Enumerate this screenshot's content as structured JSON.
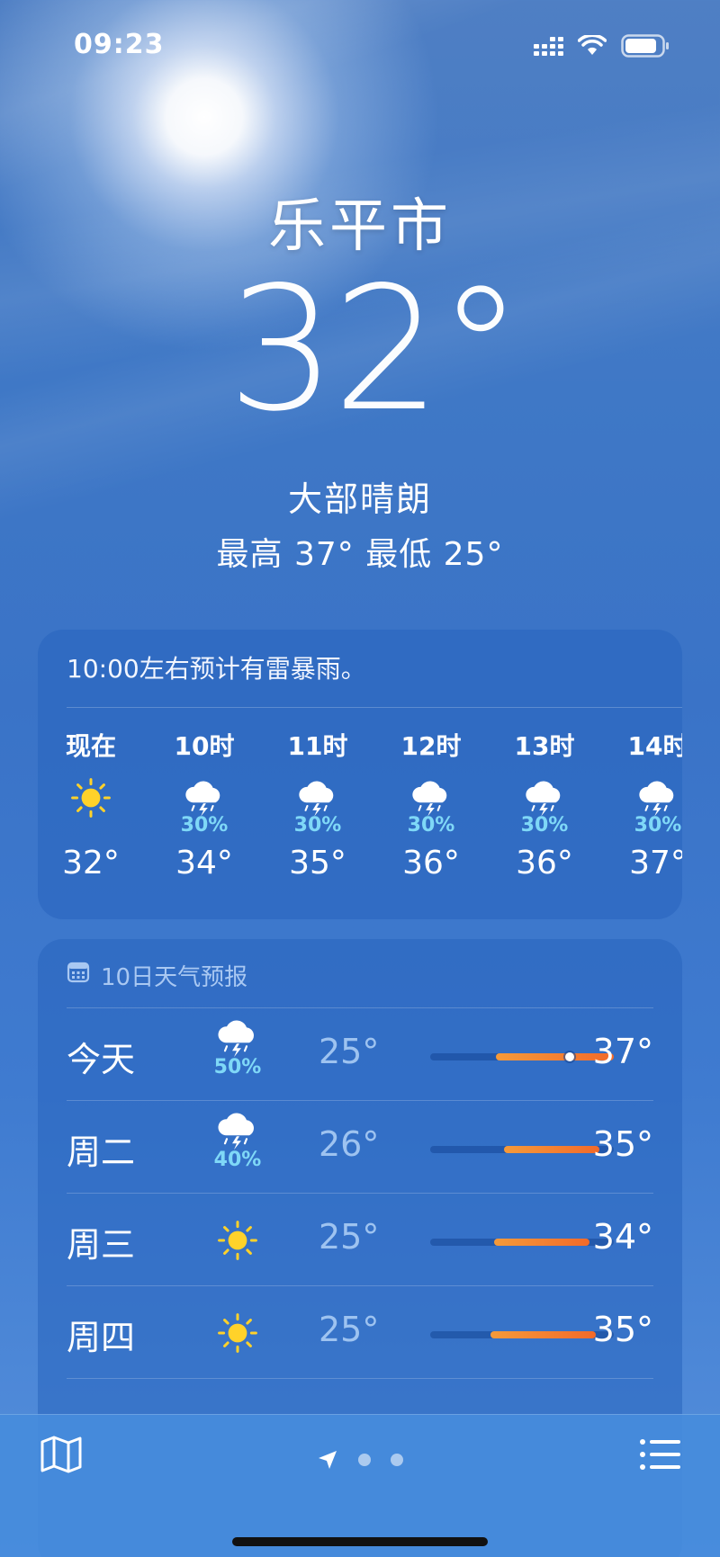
{
  "status_bar": {
    "time": "09:23"
  },
  "hero": {
    "city": "乐平市",
    "temperature": "32°",
    "condition": "大部晴朗",
    "hi_lo": "最高 37°  最低 25°"
  },
  "hourly": {
    "alert": "10:00左右预计有雷暴雨。",
    "items": [
      {
        "label": "现在",
        "icon": "sun-icon",
        "pct": "",
        "temp": "32°"
      },
      {
        "label": "10时",
        "icon": "thunderstorm-icon",
        "pct": "30%",
        "temp": "34°"
      },
      {
        "label": "11时",
        "icon": "thunderstorm-icon",
        "pct": "30%",
        "temp": "35°"
      },
      {
        "label": "12时",
        "icon": "thunderstorm-icon",
        "pct": "30%",
        "temp": "36°"
      },
      {
        "label": "13时",
        "icon": "thunderstorm-icon",
        "pct": "30%",
        "temp": "36°"
      },
      {
        "label": "14时",
        "icon": "thunderstorm-icon",
        "pct": "30%",
        "temp": "37°"
      }
    ]
  },
  "daily": {
    "header": "10日天气预报",
    "rows": [
      {
        "day": "今天",
        "icon": "thunderstorm-icon",
        "pct": "50%",
        "low": "25°",
        "high": "37°",
        "bar_start": 0.36,
        "bar_end": 1.0,
        "current_marker": 0.76
      },
      {
        "day": "周二",
        "icon": "thunderstorm-icon",
        "pct": "40%",
        "low": "26°",
        "high": "35°",
        "bar_start": 0.4,
        "bar_end": 0.92
      },
      {
        "day": "周三",
        "icon": "sun-icon",
        "pct": "",
        "low": "25°",
        "high": "34°",
        "bar_start": 0.35,
        "bar_end": 0.87
      },
      {
        "day": "周四",
        "icon": "sun-icon",
        "pct": "",
        "low": "25°",
        "high": "35°",
        "bar_start": 0.33,
        "bar_end": 0.9
      }
    ]
  },
  "colors": {
    "accent_bar": "#f26a2a",
    "precip": "#7fd8f7",
    "sun": "#ffd22a"
  }
}
